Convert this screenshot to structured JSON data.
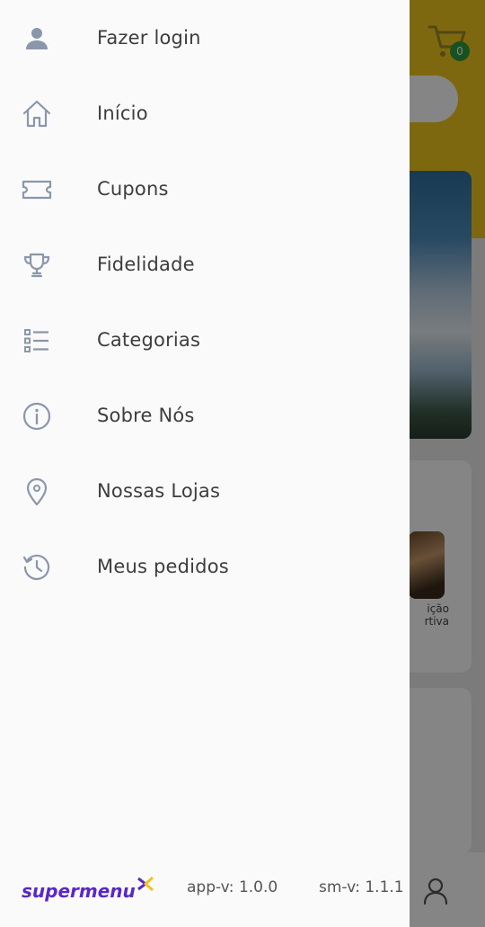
{
  "drawer": {
    "items": [
      {
        "label": "Fazer login",
        "icon": "person-icon"
      },
      {
        "label": "Início",
        "icon": "home-icon"
      },
      {
        "label": "Cupons",
        "icon": "ticket-icon"
      },
      {
        "label": "Fidelidade",
        "icon": "trophy-icon"
      },
      {
        "label": "Categorias",
        "icon": "list-icon"
      },
      {
        "label": "Sobre Nós",
        "icon": "info-icon"
      },
      {
        "label": "Nossas Lojas",
        "icon": "location-pin-icon"
      },
      {
        "label": "Meus pedidos",
        "icon": "history-icon"
      }
    ],
    "footer": {
      "logo_text": "supermenu",
      "app_version": "app-v: 1.0.0",
      "sm_version": "sm-v: 1.1.1"
    }
  },
  "background": {
    "cart_count": "0",
    "thumb_label": "ição\nrtiva"
  },
  "colors": {
    "header_yellow": "#f2c81d",
    "icon_gray": "#8a97ab",
    "brand_purple": "#5a27c8",
    "brand_yellow": "#f4c21a",
    "badge_green": "#2e9b3f"
  }
}
